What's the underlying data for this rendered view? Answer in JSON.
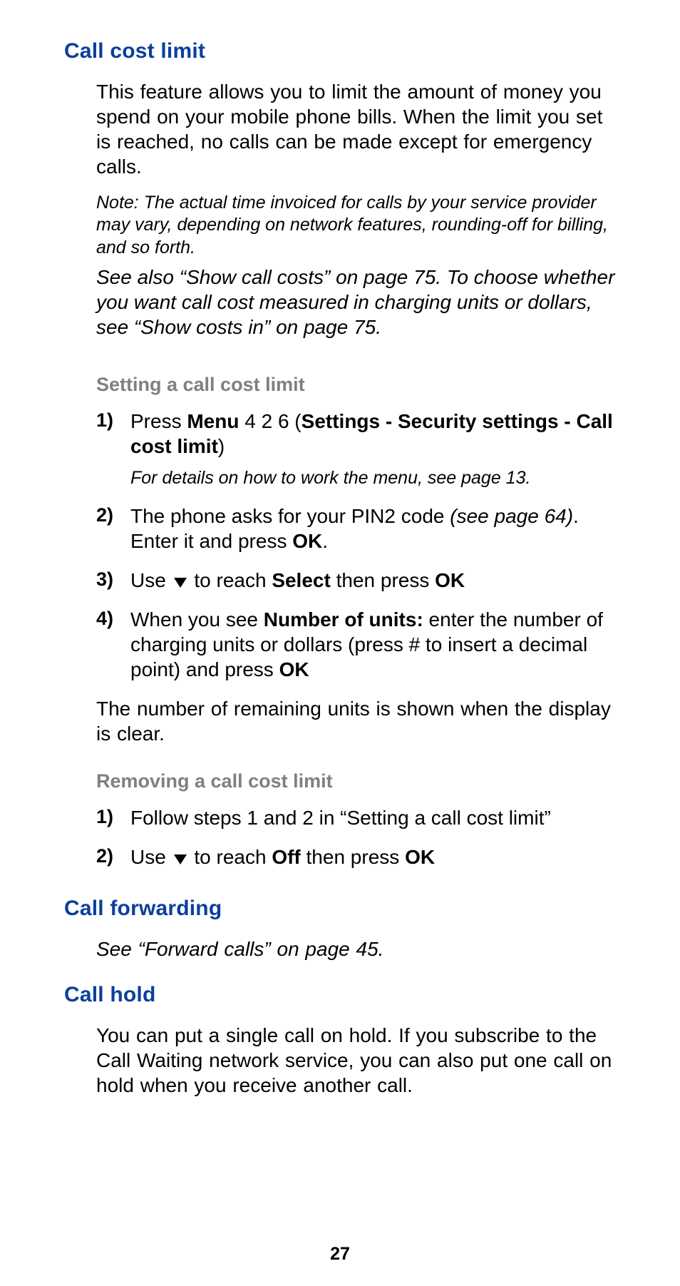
{
  "page_number": "27",
  "sections": {
    "call_cost_limit": {
      "title": "Call cost limit",
      "intro": "This feature allows you to limit the amount of money you spend on your mobile phone bills. When the limit you set is reached, no calls can be made except for emergency calls.",
      "note": "Note: The actual time invoiced for calls by your service provider may vary, depending on network features, rounding-off for billing, and so forth.",
      "see_also": "See also “Show call costs” on page 75. To choose whether you want call cost measured in charging units or dollars, see “Show costs in” on page 75.",
      "setting": {
        "title": "Setting a call cost limit",
        "steps": {
          "s1_num": "1)",
          "s1_a": "Press ",
          "s1_menu": "Menu",
          "s1_b": " 4 2 6 (",
          "s1_path": "Settings - Security settings - Call cost limit",
          "s1_c": ")",
          "s1_sub": "For details on how to work the menu, see page 13.",
          "s2_num": "2)",
          "s2_a": "The phone asks for your PIN2 code ",
          "s2_ref": "(see page 64)",
          "s2_b": ". Enter it and press ",
          "s2_ok": "OK",
          "s2_c": ".",
          "s3_num": "3)",
          "s3_a": "Use ",
          "s3_b": " to reach ",
          "s3_select": "Select",
          "s3_c": " then press ",
          "s3_ok": "OK",
          "s4_num": "4)",
          "s4_a": "When you see ",
          "s4_label": "Number of units:",
          "s4_b": " enter the number of charging units or dollars (press # to insert a decimal point) and press ",
          "s4_ok": "OK"
        },
        "after": "The number of remaining units is shown when the display is clear."
      },
      "removing": {
        "title": "Removing a call cost limit",
        "steps": {
          "r1_num": "1)",
          "r1": "Follow steps 1 and 2 in “Setting a call cost limit”",
          "r2_num": "2)",
          "r2_a": "Use ",
          "r2_b": " to reach ",
          "r2_off": "Off",
          "r2_c": " then press ",
          "r2_ok": "OK"
        }
      }
    },
    "call_forwarding": {
      "title": "Call forwarding",
      "body": "See “Forward calls” on page 45."
    },
    "call_hold": {
      "title": "Call hold",
      "body": "You can put a single call on hold. If you subscribe to the Call Waiting network service, you can also put one call on hold when you receive another call."
    }
  }
}
